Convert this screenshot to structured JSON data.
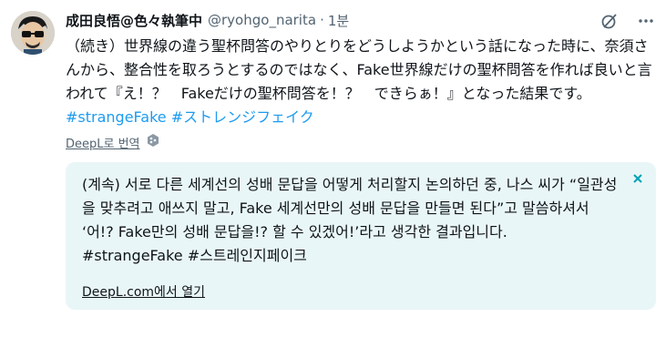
{
  "author": {
    "name": "成田良悟@色々執筆中",
    "handle": "@ryohgo_narita",
    "separator": "·",
    "time": "1분"
  },
  "header_icons": [
    "grok-icon",
    "more-options-icon"
  ],
  "tweet": {
    "text": "（続き）世界線の違う聖杯問答のやりとりをどうしようかという話になった時に、奈須さんから、整合性を取ろうとするのではなく、Fake世界線だけの聖杯問答を作れば良いと言われて『え！？　Fakeだけの聖杯問答を！？　できらぁ！』となった結果です。",
    "hashtags": [
      "#strangeFake",
      "#ストレンジフェイク"
    ]
  },
  "translation": {
    "link_label": "DeepL로 번역",
    "text": "(계속) 서로 다른 세계선의 성배 문답을 어떻게 처리할지 논의하던 중, 나스 씨가 “일관성을 맞추려고 애쓰지 말고, Fake 세계선만의 성배 문답을 만들면 된다”고 말씀하셔서 ‘어!? Fake만의 성배 문답을!? 할 수 있겠어!’라고 생각한 결과입니다.",
    "hashtags": [
      "#strangeFake",
      "#스트레인지페이크"
    ],
    "open_link": "DeepL.com에서 열기"
  },
  "colors": {
    "link": "#1d9bf0",
    "secondary_text": "#536471",
    "panel_background": "#e9f6f7",
    "close_icon": "#00a3b4"
  }
}
